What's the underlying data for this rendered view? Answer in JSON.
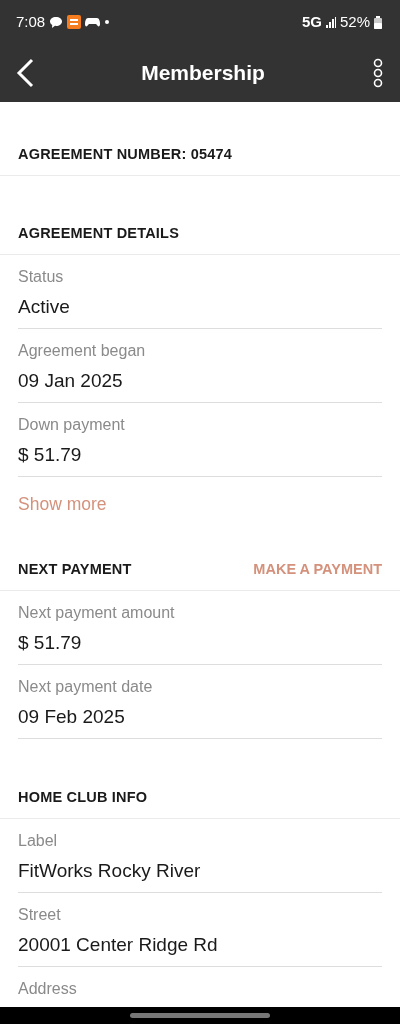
{
  "status_bar": {
    "time": "7:08",
    "network": "5G",
    "battery": "52%"
  },
  "header": {
    "title": "Membership"
  },
  "sections": [
    {
      "title": "AGREEMENT NUMBER: 05474"
    },
    {
      "title": "AGREEMENT DETAILS",
      "fields": [
        {
          "label": "Status",
          "value": "Active"
        },
        {
          "label": "Agreement began",
          "value": "09 Jan 2025"
        },
        {
          "label": "Down payment",
          "value": "$ 51.79"
        }
      ],
      "link": "Show more"
    },
    {
      "title": "NEXT PAYMENT",
      "action": "MAKE A PAYMENT",
      "fields": [
        {
          "label": "Next payment amount",
          "value": "$ 51.79"
        },
        {
          "label": "Next payment date",
          "value": "09 Feb 2025"
        }
      ]
    },
    {
      "title": "HOME CLUB INFO",
      "fields": [
        {
          "label": "Label",
          "value": "FitWorks Rocky River"
        },
        {
          "label": "Street",
          "value": "20001 Center Ridge Rd"
        },
        {
          "label": "Address"
        }
      ]
    }
  ]
}
